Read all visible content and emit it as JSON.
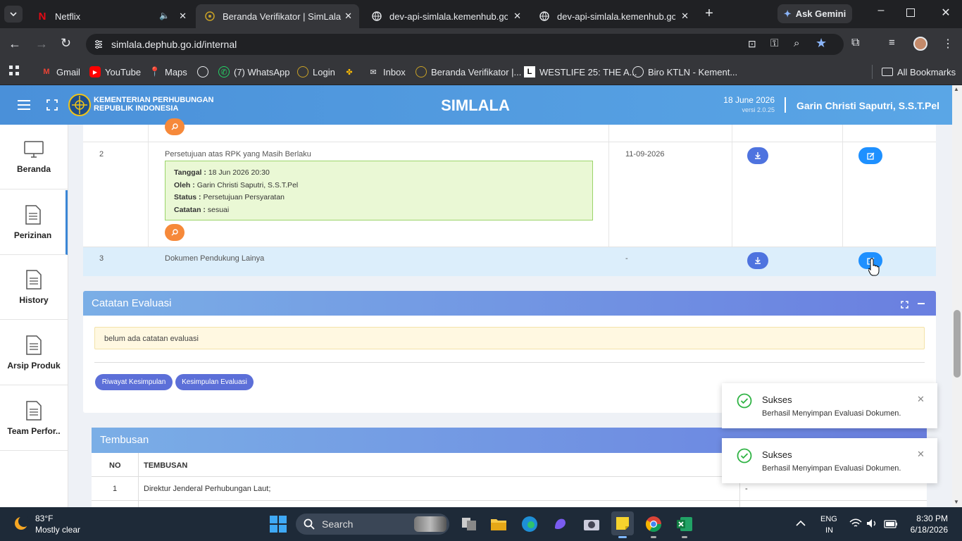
{
  "browser": {
    "tabs": [
      {
        "title": "Netflix",
        "icon": "netflix-icon"
      },
      {
        "title": "Beranda Verifikator | SimLala",
        "icon": "simlala-icon"
      },
      {
        "title": "dev-api-simlala.kemenhub.go.id",
        "icon": "globe-icon"
      },
      {
        "title": "dev-api-simlala.kemenhub.go.id",
        "icon": "globe-icon"
      }
    ],
    "ask_gemini": "Ask Gemini",
    "url": "simlala.dephub.go.id/internal",
    "bookmarks": [
      "Gmail",
      "YouTube",
      "Maps",
      "",
      "(7) WhatsApp",
      "Login",
      "",
      "Inbox",
      "Beranda Verifikator |...",
      "WESTLIFE 25: THE A...",
      "Biro KTLN - Kement..."
    ],
    "all_bookmarks": "All Bookmarks"
  },
  "header": {
    "org_line1": "KEMENTERIAN PERHUBUNGAN",
    "org_line2": "REPUBLIK INDONESIA",
    "app_title": "SIMLALA",
    "date": "18 June 2026",
    "version": "versi 2.0.25",
    "user": "Garin Christi Saputri, S.S.T.Pel"
  },
  "sidebar": {
    "items": [
      {
        "label": "Beranda",
        "icon": "monitor-icon"
      },
      {
        "label": "Perizinan",
        "icon": "document-icon"
      },
      {
        "label": "History",
        "icon": "document-icon"
      },
      {
        "label": "Arsip Produk",
        "icon": "document-icon"
      },
      {
        "label": "Team Perfor..",
        "icon": "document-icon"
      }
    ]
  },
  "documents": {
    "rows": [
      {
        "no": "2",
        "name": "Persetujuan atas RPK yang Masih Berlaku",
        "date": "11-09-2026",
        "note": {
          "tanggal_label": "Tanggal :",
          "tanggal": "18 Jun 2026 20:30",
          "oleh_label": "Oleh :",
          "oleh": "Garin Christi Saputri, S.S.T.Pel",
          "status_label": "Status :",
          "status": "Persetujuan Persyaratan",
          "catatan_label": "Catatan :",
          "catatan": "sesuai"
        }
      },
      {
        "no": "3",
        "name": "Dokumen Pendukung Lainya",
        "date": "-"
      }
    ]
  },
  "evaluasi": {
    "title": "Catatan Evaluasi",
    "empty_note": "belum ada catatan evaluasi",
    "btn_riwayat": "Riwayat Kesimpulan",
    "btn_kesimpulan": "Kesimpulan Evaluasi"
  },
  "tembusan": {
    "title": "Tembusan",
    "col_no": "NO",
    "col_name": "TEMBUSAN",
    "rows": [
      {
        "no": "1",
        "name": "Direktur Jenderal Perhubungan Laut;",
        "extra": "-"
      }
    ]
  },
  "toasts": [
    {
      "title": "Sukses",
      "message": "Berhasil Menyimpan Evaluasi Dokumen."
    },
    {
      "title": "Sukses",
      "message": "Berhasil Menyimpan Evaluasi Dokumen."
    }
  ],
  "taskbar": {
    "temp": "83°F",
    "weather": "Mostly clear",
    "search": "Search",
    "lang1": "ENG",
    "lang2": "IN",
    "time": "8:30 PM",
    "date": "6/18/2026"
  },
  "colors": {
    "header_blue": "#4a90d9",
    "success_green": "#2fb344",
    "note_green": "#eaf8d5",
    "warning_yellow": "#fff8e1"
  }
}
